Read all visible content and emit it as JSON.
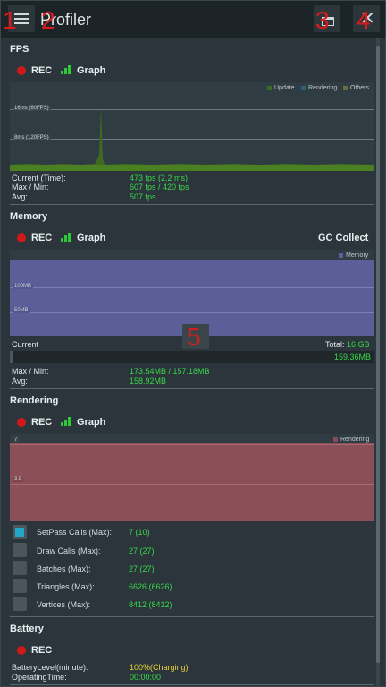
{
  "header": {
    "title": "Profiler",
    "markers": [
      "1",
      "2",
      "3",
      "4",
      "5"
    ]
  },
  "fps": {
    "title": "FPS",
    "rec_label": "REC",
    "graph_label": "Graph",
    "legend": [
      "Update",
      "Rendering",
      "Others"
    ],
    "legend_colors": [
      "#3d6b2a",
      "#2f5f7a",
      "#6a6a3a"
    ],
    "line_labels": [
      "16ms (60FPS)",
      "8ms (120FPS)"
    ],
    "stats": [
      {
        "label": "Current (Time):",
        "value": "473 fps (2.2 ms)"
      },
      {
        "label": "Max / Min:",
        "value": "607 fps / 420 fps"
      },
      {
        "label": "Avg:",
        "value": "507 fps"
      }
    ]
  },
  "memory": {
    "title": "Memory",
    "rec_label": "REC",
    "graph_label": "Graph",
    "gc_label": "GC Collect",
    "legend": "Memory",
    "line_labels": [
      "100MB",
      "50MB"
    ],
    "current_label": "Current",
    "total_label": "Total:",
    "total_value": "16 GB",
    "current_value": "159.36MB",
    "stats": [
      {
        "label": "Max / Min:",
        "value": "173.54MB / 157.18MB"
      },
      {
        "label": "Avg:",
        "value": "158.92MB"
      }
    ]
  },
  "rendering": {
    "title": "Rendering",
    "rec_label": "REC",
    "graph_label": "Graph",
    "legend": "Rendering",
    "line_labels": [
      "7",
      "3.5"
    ],
    "items": [
      {
        "label": "SetPass Calls (Max):",
        "value": "7 (10)",
        "checked": true
      },
      {
        "label": "Draw Calls (Max):",
        "value": "27 (27)",
        "checked": false
      },
      {
        "label": "Batches (Max):",
        "value": "27 (27)",
        "checked": false
      },
      {
        "label": "Triangles (Max):",
        "value": "6626 (6626)",
        "checked": false
      },
      {
        "label": "Vertices (Max):",
        "value": "8412 (8412)",
        "checked": false
      }
    ]
  },
  "battery": {
    "title": "Battery",
    "rec_label": "REC",
    "stats": [
      {
        "label": "BatteryLevel(minute):",
        "value": "100%(Charging)"
      },
      {
        "label": "OperatingTime:",
        "value": "00:00:00"
      }
    ]
  }
}
